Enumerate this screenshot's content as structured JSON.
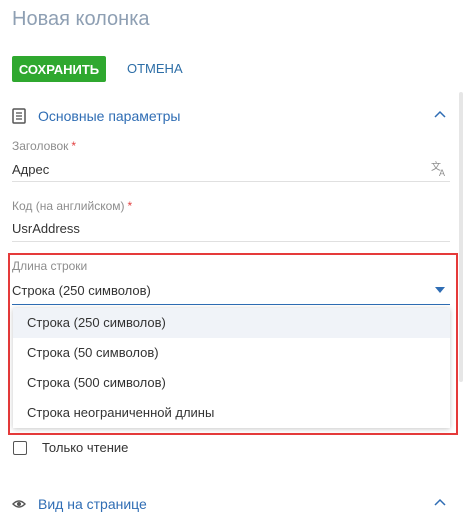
{
  "page": {
    "title": "Новая колонка"
  },
  "toolbar": {
    "save_label": "СОХРАНИТЬ",
    "cancel_label": "ОТМЕНА"
  },
  "section_main": {
    "title": "Основные параметры",
    "icon": "list-document-icon",
    "collapse_icon": "chevron-up-icon"
  },
  "fields": {
    "header": {
      "label": "Заголовок",
      "required_mark": "*",
      "value": "Адрес",
      "icon": "translate-icon"
    },
    "code": {
      "label": "Код (на английском)",
      "required_mark": "*",
      "value": "UsrAddress"
    },
    "length": {
      "label": "Длина строки",
      "value": "Строка (250 символов)",
      "caret_icon": "caret-down-icon"
    }
  },
  "dropdown": {
    "options": [
      "Строка (250 символов)",
      "Строка (50 символов)",
      "Строка (500 символов)",
      "Строка неограниченной длины"
    ],
    "selected_index": 0
  },
  "readonly": {
    "label": "Только чтение",
    "checked": false
  },
  "section_view": {
    "title": "Вид на странице",
    "icon": "eye-icon",
    "collapse_icon": "chevron-up-icon"
  },
  "colors": {
    "accent": "#2f6db4",
    "save": "#2fa82f",
    "highlight": "#e53a3a",
    "title": "#8e9fb3"
  }
}
